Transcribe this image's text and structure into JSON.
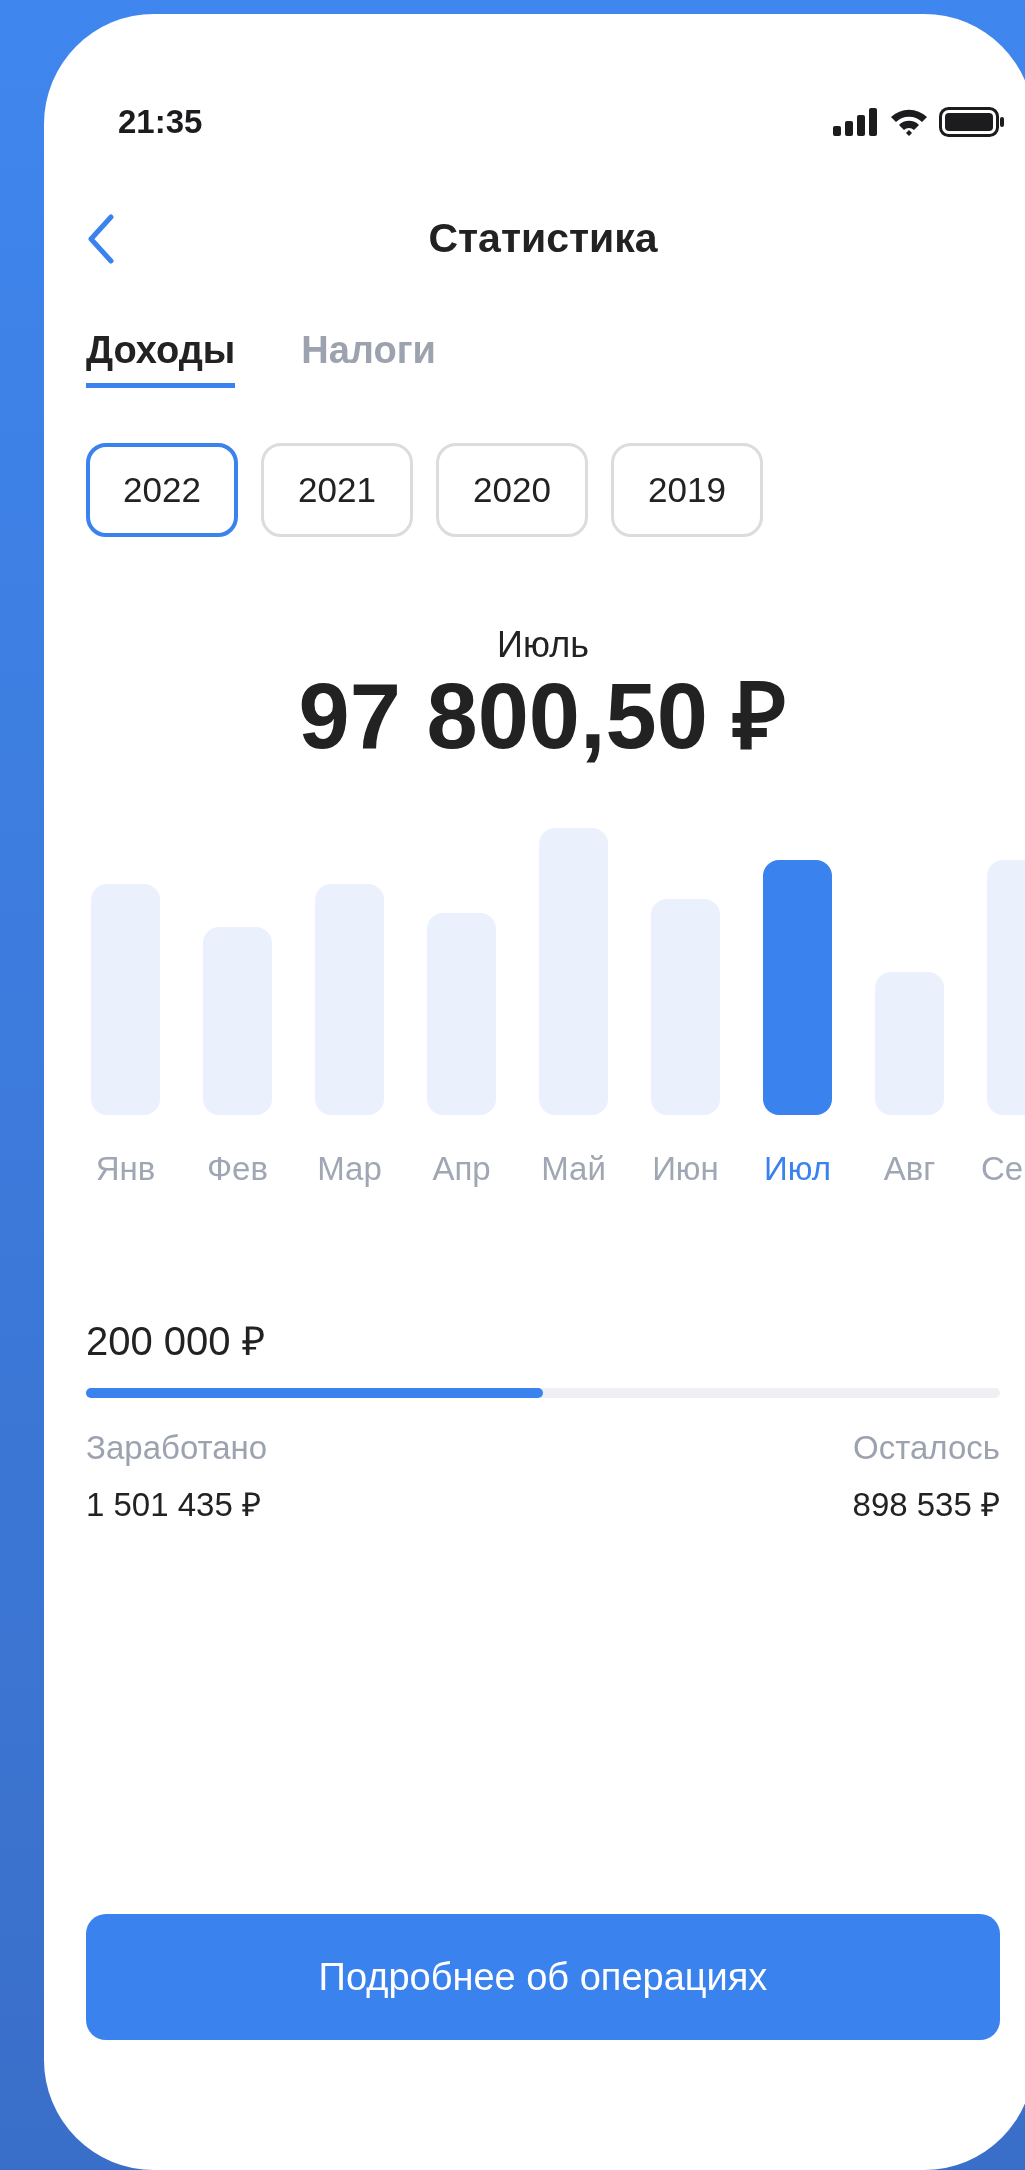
{
  "status_bar": {
    "time": "21:35"
  },
  "header": {
    "title": "Статистика"
  },
  "tabs": [
    {
      "label": "Доходы",
      "selected": true
    },
    {
      "label": "Налоги",
      "selected": false
    }
  ],
  "years": [
    {
      "label": "2022",
      "selected": true
    },
    {
      "label": "2021",
      "selected": false
    },
    {
      "label": "2020",
      "selected": false
    },
    {
      "label": "2019",
      "selected": false
    }
  ],
  "period": {
    "month": "Июль",
    "amount": "97 800,50 ₽"
  },
  "months": [
    {
      "label": "Янв",
      "selected": false
    },
    {
      "label": "Фев",
      "selected": false
    },
    {
      "label": "Мар",
      "selected": false
    },
    {
      "label": "Апр",
      "selected": false
    },
    {
      "label": "Май",
      "selected": false
    },
    {
      "label": "Июн",
      "selected": false
    },
    {
      "label": "Июл",
      "selected": true
    },
    {
      "label": "Авг",
      "selected": false
    },
    {
      "label": "Се",
      "selected": false
    }
  ],
  "goal": {
    "amount": "200 000 ₽",
    "level": 0.5,
    "earned_label": "Заработано",
    "earned": "1 501 435 ₽",
    "left_label": "Осталось",
    "left": "898 535 ₽"
  },
  "button": {
    "label": "Подробнее об операциях"
  }
}
